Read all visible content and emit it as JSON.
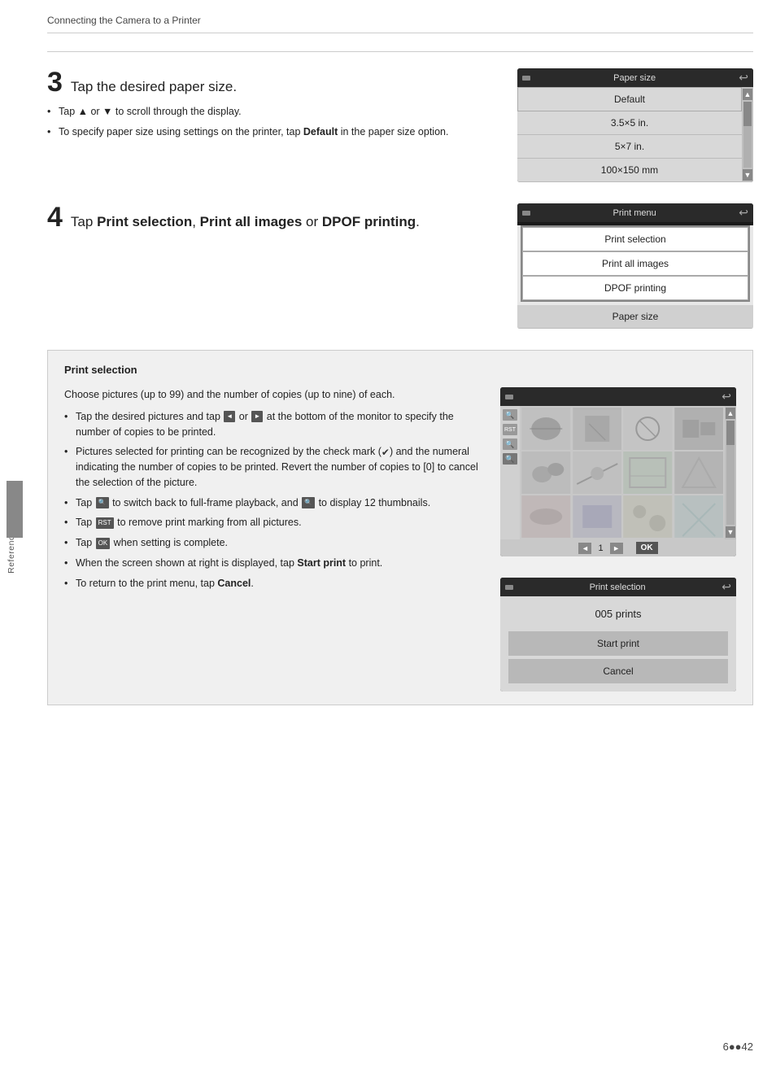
{
  "page": {
    "header": "Connecting the Camera to a Printer",
    "footer_page": "6●42"
  },
  "sidebar": {
    "label": "Reference Section"
  },
  "step3": {
    "number": "3",
    "title": "Tap the desired paper size.",
    "bullets": [
      "Tap ▲ or ▼ to scroll through the display.",
      "To specify paper size using settings on the printer, tap Default in the paper size option."
    ],
    "screen": {
      "title": "Paper size",
      "items": [
        "Default",
        "3.5×5 in.",
        "5×7 in.",
        "100×150 mm"
      ]
    }
  },
  "step4": {
    "number": "4",
    "title_prefix": "Tap ",
    "bold1": "Print selection",
    "title_mid": ", ",
    "bold2": "Print all images",
    "title_suffix": " or ",
    "bold3": "DPOF printing",
    "title_end": ".",
    "screen": {
      "title": "Print menu",
      "items": [
        "Print selection",
        "Print all images",
        "DPOF printing",
        "Paper size"
      ],
      "highlighted": [
        0,
        1,
        2
      ]
    }
  },
  "print_selection": {
    "header": "Print selection",
    "intro": "Choose pictures (up to 99) and the number of copies (up to nine) of each.",
    "bullets": [
      "Tap the desired pictures and tap ◄ or ► at the bottom of the monitor to specify the number of copies to be printed.",
      "Pictures selected for printing can be recognized by the check mark (✔) and the numeral indicating the number of copies to be printed. Revert the number of copies to [0] to cancel the selection of the picture.",
      "Tap 🔍 to switch back to full-frame playback, and 🔍 to display 12 thumbnails.",
      "Tap RESET to remove print marking from all pictures.",
      "Tap OK when setting is complete.",
      "When the screen shown at right is displayed, tap Start print to print.",
      "To return to the print menu, tap Cancel."
    ],
    "dialog": {
      "title": "Print selection",
      "count": "005  prints",
      "start_btn": "Start print",
      "cancel_btn": "Cancel"
    }
  }
}
